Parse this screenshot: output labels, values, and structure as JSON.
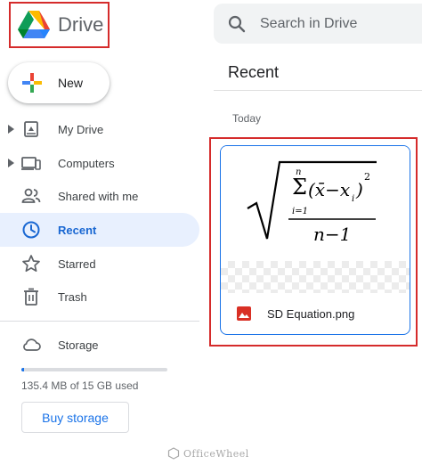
{
  "header": {
    "app_name": "Drive",
    "search_placeholder": "Search in Drive"
  },
  "sidebar": {
    "new_label": "New",
    "items": [
      {
        "label": "My Drive",
        "icon": "my-drive-icon",
        "expandable": true
      },
      {
        "label": "Computers",
        "icon": "computers-icon",
        "expandable": true
      },
      {
        "label": "Shared with me",
        "icon": "shared-with-me-icon",
        "expandable": false
      },
      {
        "label": "Recent",
        "icon": "clock-icon",
        "expandable": false,
        "active": true
      },
      {
        "label": "Starred",
        "icon": "star-icon",
        "expandable": false
      },
      {
        "label": "Trash",
        "icon": "trash-icon",
        "expandable": false
      }
    ],
    "storage": {
      "label": "Storage",
      "used_text": "135.4 MB of 15 GB used",
      "used_fraction": 0.009,
      "buy_label": "Buy storage"
    }
  },
  "main": {
    "title": "Recent",
    "section": "Today",
    "files": [
      {
        "name": "SD Equation.png",
        "icon": "image-file-icon"
      }
    ]
  },
  "watermark": "OfficeWheel",
  "colors": {
    "accent": "#1a73e8",
    "active_bg": "#e8f0fe",
    "highlight_border": "#d52b2b",
    "image_icon": "#d93025"
  }
}
